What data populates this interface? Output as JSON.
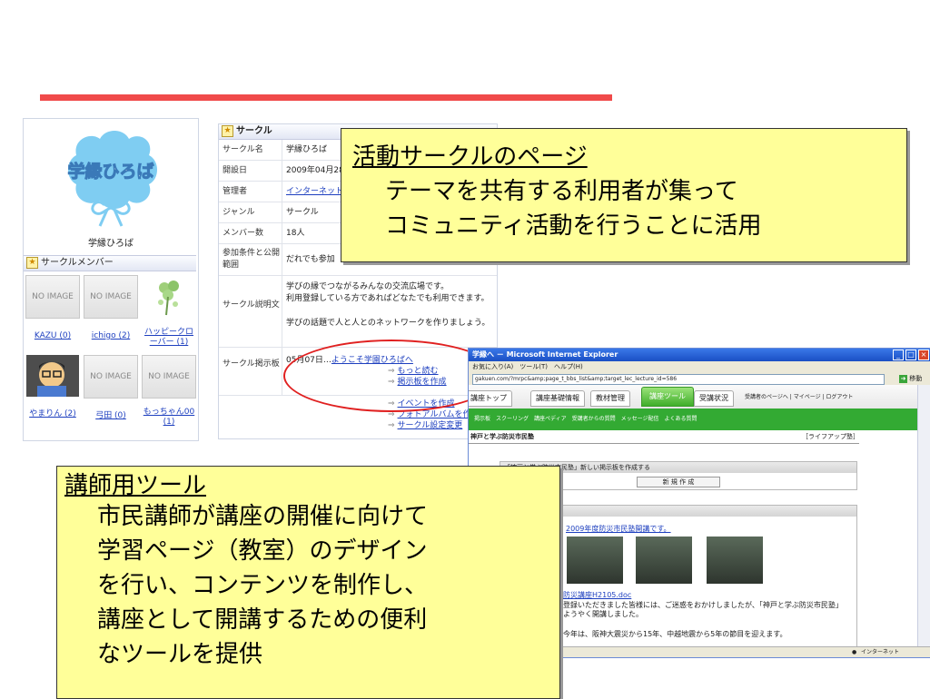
{
  "profile": {
    "logo_text": "学縁ひろば",
    "name": "学縁ひろば",
    "members_title": "サークルメンバー",
    "members": [
      {
        "img": "NO IMAGE",
        "name": "KAZU (0)"
      },
      {
        "img": "NO IMAGE",
        "name": "ichigo (2)"
      },
      {
        "img": "",
        "name": "ハッピークローバー (1)"
      },
      {
        "img": "",
        "name": "やまりん (2)"
      },
      {
        "img": "NO IMAGE",
        "name": "弓田 (0)"
      },
      {
        "img": "NO IMAGE",
        "name": "もっちゃん00 (1)"
      }
    ]
  },
  "circle": {
    "title": "サークル",
    "rows": [
      {
        "label": "サークル名",
        "value": "学縁ひろば"
      },
      {
        "label": "開設日",
        "value": "2009年04月28"
      },
      {
        "label": "管理者",
        "value": "インターネット"
      },
      {
        "label": "ジャンル",
        "value": "サークル"
      },
      {
        "label": "メンバー数",
        "value": "18人"
      },
      {
        "label": "参加条件と公開範囲",
        "value": "だれでも参加"
      }
    ],
    "desc_label": "サークル説明文",
    "desc_1": "学びの縁でつながるみんなの交流広場です。",
    "desc_2": "利用登録している方であればどなたでも利用できます。",
    "desc_3": "学びの話題で人と人とのネットワークを作りましょう。",
    "board_label": "サークル掲示板",
    "board_date": "05月07日…",
    "board_post": "ようこそ学園ひろばへ",
    "read_more": "もっと読む",
    "create_board": "掲示板を作成",
    "event_create": "イベントを作成",
    "album_create": "フォトアルバムを作成",
    "settings_change": "サークル設定変更"
  },
  "callout1": {
    "title": "活動サークルのページ",
    "line1": "テーマを共有する利用者が集って",
    "line2": "コミュニティ活動を行うことに活用"
  },
  "callout2": {
    "title": "講師用ツール",
    "line1": "市民講師が講座の開催に向けて",
    "line2": "学習ページ（教室）のデザイン",
    "line3": "を行い、コンテンツを制作し、",
    "line4": "講座として開講するための便利",
    "line5": "なツールを提供"
  },
  "ie": {
    "title": "学縁へ － Microsoft Internet Explorer",
    "menu": "お気に入り(A)　ツール(T)　ヘルプ(H)",
    "url": "gakuen.com/?mrpc&amp;page_t_bbs_list&amp;target_lec_lecture_id=586",
    "go": "移動",
    "tabs": [
      "講座トップ",
      "講座基礎情報",
      "教材管理",
      "講座ツール",
      "受講状況"
    ],
    "tab_right": "受講者のページへ | マイページ | ログアウト",
    "subnav": "掲示板　スクーリング　講座ペディア　受講者からの質問　メッセージ配信　よくある質問",
    "section_title": "神戸と学ぶ防災市民塾",
    "section_right": "［ライフアップ塾］",
    "box_title": "「神戸と学ぶ防災市民塾」新しい掲示板を作成する",
    "new_button": "新 規 作 成",
    "post_link": "2009年度防災市民塾開講です。",
    "file_link": "防災講座H2105.doc",
    "text1": "登録いただきました皆様には、ご迷惑をおかけしましたが、「神戸と学ぶ防災市民塾」",
    "text2": "ようやく開講しました。",
    "text3": "今年は、阪神大震災から15年、中越地震から5年の節目を迎えます。",
    "status": "インターネット"
  },
  "colors": {
    "accent_red": "#f04a4a",
    "callout_yellow": "#ffff99",
    "link_blue": "#1d3fbf",
    "ie_green": "#33aa33"
  }
}
